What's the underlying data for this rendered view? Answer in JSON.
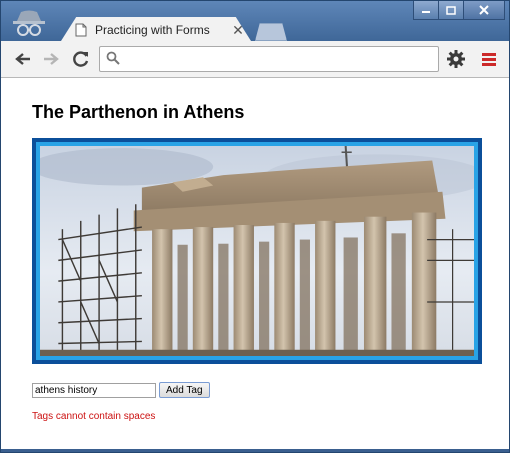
{
  "browser": {
    "tab_title": "Practicing with Forms",
    "tab_close": "✕",
    "address_value": "",
    "address_placeholder": ""
  },
  "page": {
    "heading": "The Parthenon in Athens",
    "image_subject": "parthenon-photo",
    "tag_input_value": "athens history",
    "add_tag_label": "Add Tag",
    "error_message": "Tags cannot contain spaces"
  },
  "colors": {
    "frame_outer": "#0b4f9a",
    "frame_inner": "#29a3e6",
    "error": "#cc1111",
    "titlebar": "#3f6798"
  }
}
